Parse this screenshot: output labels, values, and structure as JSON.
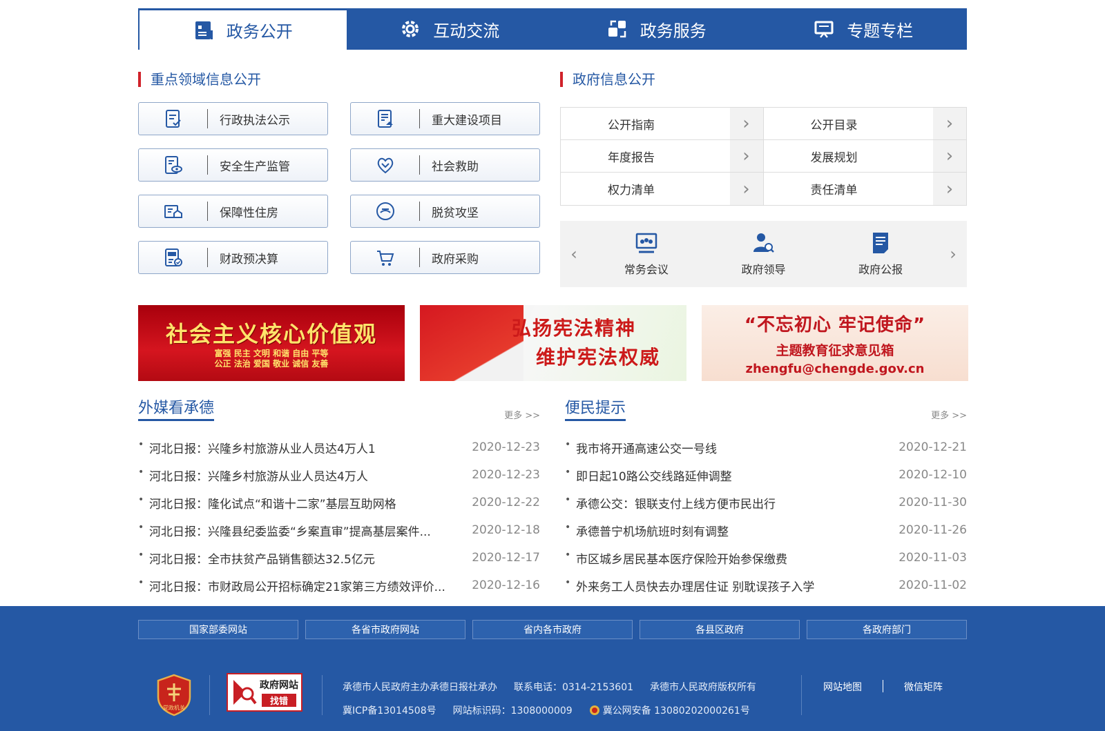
{
  "nav": {
    "tabs": [
      {
        "label": "政务公开",
        "icon": "document-list-icon"
      },
      {
        "label": "互动交流",
        "icon": "gear-icon"
      },
      {
        "label": "政务服务",
        "icon": "service-exchange-icon"
      },
      {
        "label": "专题专栏",
        "icon": "presentation-board-icon"
      }
    ]
  },
  "left_section": {
    "title": "重点领域信息公开",
    "buttons": [
      {
        "label": "行政执法公示",
        "icon": "law-document-icon"
      },
      {
        "label": "重大建设项目",
        "icon": "construction-project-icon"
      },
      {
        "label": "安全生产监管",
        "icon": "safety-supervision-icon"
      },
      {
        "label": "社会救助",
        "icon": "heart-hands-icon"
      },
      {
        "label": "保障性住房",
        "icon": "housing-icon"
      },
      {
        "label": "脱贫攻坚",
        "icon": "poverty-alleviation-icon"
      },
      {
        "label": "财政预决算",
        "icon": "finance-budget-icon"
      },
      {
        "label": "政府采购",
        "icon": "shopping-cart-icon"
      }
    ]
  },
  "right_section": {
    "title": "政府信息公开",
    "table": [
      "公开指南",
      "公开目录",
      "年度报告",
      "发展规划",
      "权力清单",
      "责任清单"
    ],
    "carousel": [
      {
        "label": "常务会议",
        "icon": "meeting-icon"
      },
      {
        "label": "政府领导",
        "icon": "leader-icon"
      },
      {
        "label": "政府公报",
        "icon": "gazette-icon"
      }
    ]
  },
  "banners": {
    "b1": {
      "title": "社会主义核心价值观",
      "line1": "富强 民主 文明 和谐 自由 平等",
      "line2": "公正 法治 爱国 敬业 诚信 友善"
    },
    "b2": {
      "line1": "弘扬宪法精神",
      "line2": "维护宪法权威"
    },
    "b3": {
      "title": "“不忘初心 牢记使命”",
      "subtitle": "主题教育征求意见箱",
      "email": "zhengfu@chengde.gov.cn"
    }
  },
  "news_left": {
    "title": "外媒看承德",
    "more": "更多 >>",
    "items": [
      {
        "text": "河北日报：兴隆乡村旅游从业人员达4万人1",
        "date": "2020-12-23"
      },
      {
        "text": "河北日报：兴隆乡村旅游从业人员达4万人",
        "date": "2020-12-23"
      },
      {
        "text": "河北日报：隆化试点“和谐十二家”基层互助网格",
        "date": "2020-12-22"
      },
      {
        "text": "河北日报：兴隆县纪委监委“乡案直审”提高基层案件...",
        "date": "2020-12-18"
      },
      {
        "text": "河北日报：全市扶贫产品销售额达32.5亿元",
        "date": "2020-12-17"
      },
      {
        "text": "河北日报：市财政局公开招标确定21家第三方绩效评价...",
        "date": "2020-12-16"
      }
    ]
  },
  "news_right": {
    "title": "便民提示",
    "more": "更多 >>",
    "items": [
      {
        "text": "我市将开通高速公交一号线",
        "date": "2020-12-21"
      },
      {
        "text": "即日起10路公交线路延伸调整",
        "date": "2020-12-10"
      },
      {
        "text": "承德公交：银联支付上线方便市民出行",
        "date": "2020-11-30"
      },
      {
        "text": "承德普宁机场航班时刻有调整",
        "date": "2020-11-26"
      },
      {
        "text": "市区城乡居民基本医疗保险开始参保缴费",
        "date": "2020-11-03"
      },
      {
        "text": "外来务工人员快去办理居住证 别耽误孩子入学",
        "date": "2020-11-02"
      }
    ]
  },
  "footer": {
    "links": [
      "国家部委网站",
      "各省市政府网站",
      "省内各市政府",
      "各县区政府",
      "各政府部门"
    ],
    "emblem_text": "党政机关",
    "jiucuo_top": "政府网站",
    "jiucuo_bottom": "找错",
    "info1": [
      "承德市人民政府主办承德日报社承办",
      "联系电话：0314-2153601",
      "承德市人民政府版权所有"
    ],
    "info2": [
      "冀ICP备13014508号",
      "网站标识码：1308000009",
      "冀公网安备 13080202000261号"
    ],
    "right_links": [
      "网站地图",
      "微信矩阵"
    ]
  },
  "colors": {
    "primary": "#2558a4",
    "accent": "#d0222a"
  }
}
